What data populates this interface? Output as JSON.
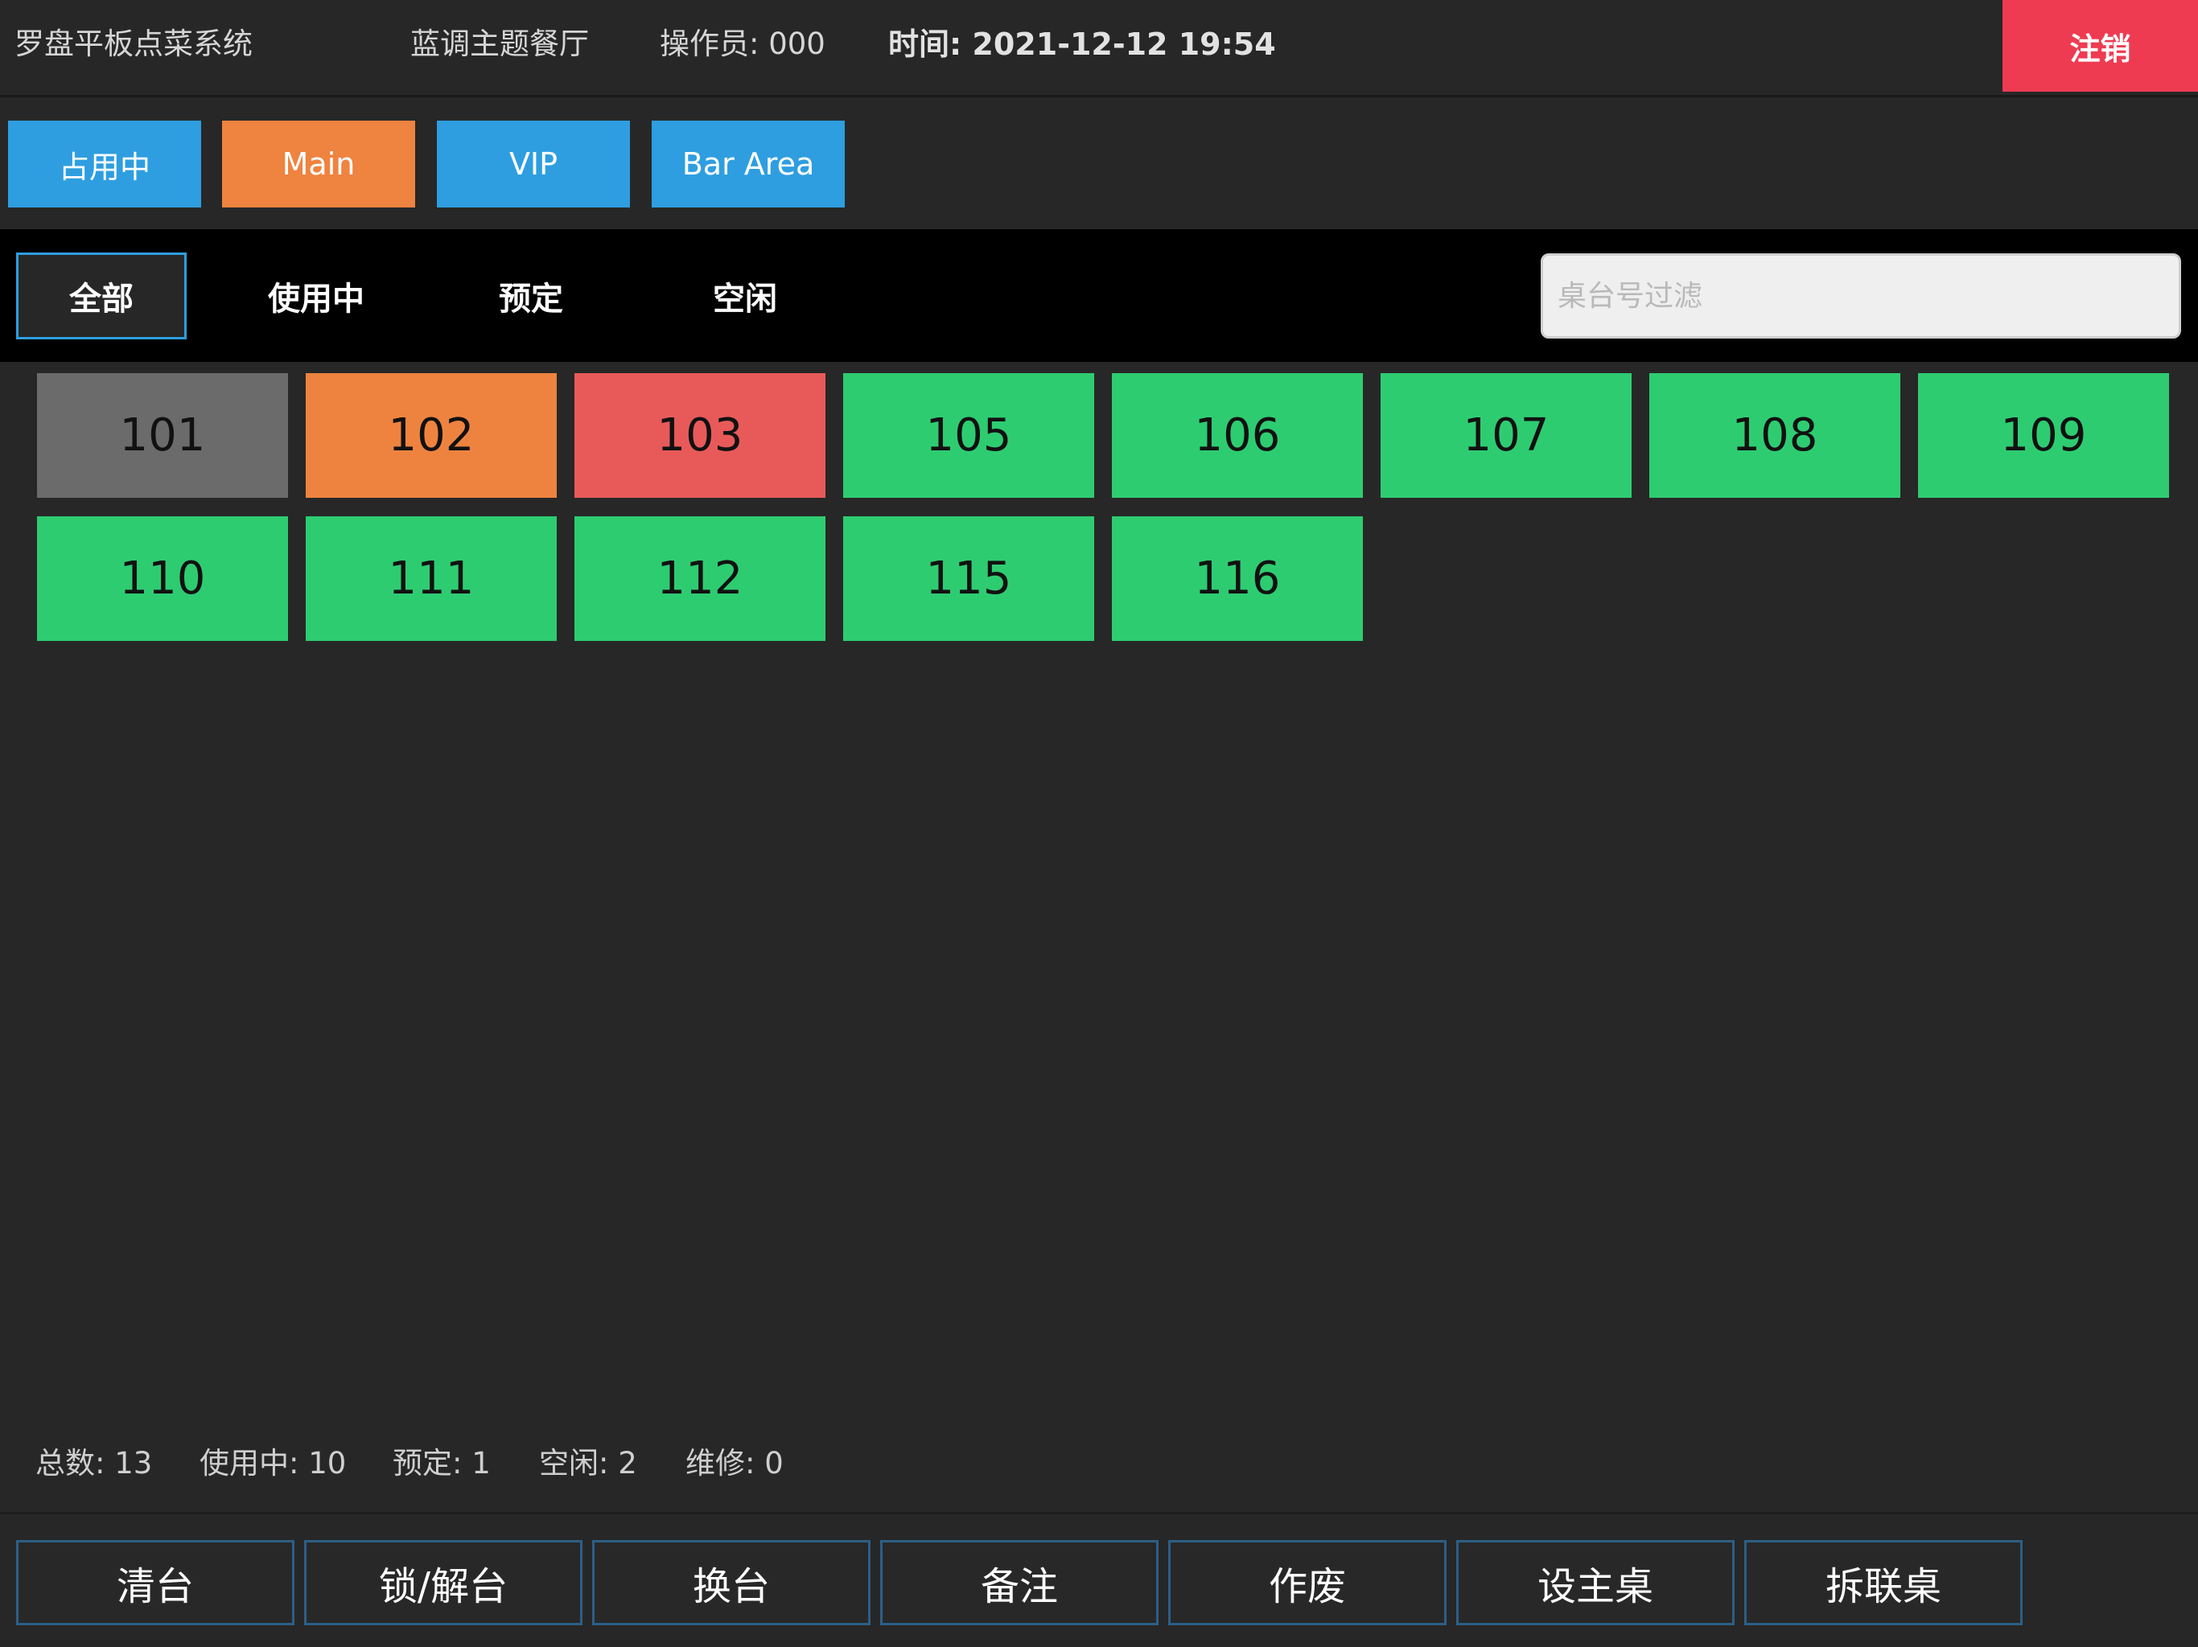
{
  "header": {
    "app_title": "罗盘平板点菜系统",
    "restaurant": "蓝调主题餐厅",
    "operator": "操作员: 000",
    "time": "时间: 2021-12-12 19:54",
    "logout_label": "注销"
  },
  "area_tabs": [
    {
      "label": "占用中",
      "active": false
    },
    {
      "label": "Main",
      "active": true
    },
    {
      "label": "VIP",
      "active": false
    },
    {
      "label": "Bar Area",
      "active": false
    }
  ],
  "filter_tabs": [
    {
      "label": "全部",
      "active": true
    },
    {
      "label": "使用中",
      "active": false
    },
    {
      "label": "预定",
      "active": false
    },
    {
      "label": "空闲",
      "active": false
    }
  ],
  "search": {
    "placeholder": "桌台号过滤",
    "value": ""
  },
  "status_colors": {
    "free": "#2ecc71",
    "used": "#ee8340",
    "reserved": "#e85a5a",
    "repair": "#6b6b6b"
  },
  "tables": [
    {
      "number": "101",
      "status": "repair"
    },
    {
      "number": "102",
      "status": "used"
    },
    {
      "number": "103",
      "status": "reserved"
    },
    {
      "number": "105",
      "status": "free"
    },
    {
      "number": "106",
      "status": "free"
    },
    {
      "number": "107",
      "status": "free"
    },
    {
      "number": "108",
      "status": "free"
    },
    {
      "number": "109",
      "status": "free"
    },
    {
      "number": "110",
      "status": "free"
    },
    {
      "number": "111",
      "status": "free"
    },
    {
      "number": "112",
      "status": "free"
    },
    {
      "number": "115",
      "status": "free"
    },
    {
      "number": "116",
      "status": "free"
    }
  ],
  "summary": {
    "total": "总数: 13",
    "in_use": "使用中: 10",
    "reserved": "预定: 1",
    "free": "空闲: 2",
    "repair": "维修: 0"
  },
  "actions": [
    {
      "label": "清台"
    },
    {
      "label": "锁/解台"
    },
    {
      "label": "换台"
    },
    {
      "label": "备注"
    },
    {
      "label": "作废"
    },
    {
      "label": "设主桌"
    },
    {
      "label": "拆联桌"
    }
  ]
}
